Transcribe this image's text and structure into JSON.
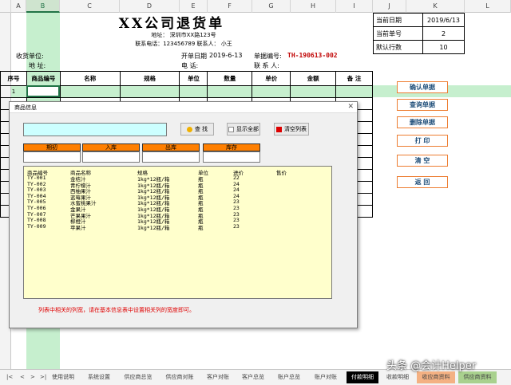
{
  "columns": [
    "A",
    "B",
    "C",
    "D",
    "E",
    "F",
    "G",
    "H",
    "I",
    "J",
    "K",
    "L"
  ],
  "title": "XX公司退货单",
  "address": "地址： 深圳市XX路123号",
  "contact": "联系电话：123456789  联系人： 小王",
  "receiver_label": "收货单位:",
  "address_label": "地    址:",
  "date_label": "开单日期",
  "date_value": "2019-6-13",
  "phone_label": "电    话:",
  "doc_no_label": "单据编号:",
  "doc_no_value": "TH-190613-002",
  "contact_label": "联 系 人:",
  "info": {
    "date_label": "当前日期",
    "date_value": "2019/6/13",
    "no_label": "当前单号",
    "no_value": "2",
    "rows_label": "默认行数",
    "rows_value": "10"
  },
  "table_headers": [
    "序号",
    "商品编号",
    "名称",
    "规格",
    "单位",
    "数量",
    "单价",
    "金额",
    "备 注"
  ],
  "first_row_no": "1",
  "side_buttons": [
    "确认单据",
    "查询单据",
    "删除单据",
    "打  印",
    "清  空",
    "返  回"
  ],
  "dialog": {
    "title": "商品信息",
    "search_btn": "查  找",
    "show_all_btn": "显示全部",
    "clear_btn": "清空列表",
    "stat_headers": [
      "期初",
      "入库",
      "出库",
      "库存"
    ],
    "list_headers": [
      "商品编号",
      "商品名称",
      "规格",
      "单位",
      "进价",
      "售价"
    ],
    "items": [
      [
        "TY-001",
        "金桔汁",
        "1kg*12瓶/箱",
        "瓶",
        "22",
        ""
      ],
      [
        "TY-002",
        "青柠檬汁",
        "1kg*12瓶/箱",
        "瓶",
        "24",
        ""
      ],
      [
        "TY-003",
        "西柚果汁",
        "1kg*12瓶/箱",
        "瓶",
        "24",
        ""
      ],
      [
        "TY-004",
        "蓝莓果汁",
        "1kg*12瓶/箱",
        "瓶",
        "24",
        ""
      ],
      [
        "TY-005",
        "水蜜桃果汁",
        "1kg*12瓶/箱",
        "瓶",
        "23",
        ""
      ],
      [
        "TY-006",
        "金果汁",
        "1kg*12瓶/箱",
        "瓶",
        "23",
        ""
      ],
      [
        "TY-007",
        "芒果果汁",
        "1kg*12瓶/箱",
        "瓶",
        "23",
        ""
      ],
      [
        "TY-008",
        "柳橙汁",
        "1kg*12瓶/箱",
        "瓶",
        "23",
        ""
      ],
      [
        "TY-009",
        "苹果汁",
        "1kg*12瓶/箱",
        "瓶",
        "23",
        ""
      ]
    ],
    "hint": "列表中相关的列宽，请在基本信息表中设置相关列的宽度即可。"
  },
  "sheet_tabs": [
    "使用说明",
    "系统设置",
    "供应商总览",
    "供应商对账",
    "客户对账",
    "客户总览",
    "账户总览",
    "账户对账",
    "付款明细",
    "收款明细",
    "收应商资料",
    "供应商资料"
  ],
  "watermark": "头条 @会计Helper",
  "colors": {
    "accent_orange": "#ff7f00",
    "excel_green": "#217346",
    "list_bg": "#ffffcc",
    "search_bg": "#ccffff"
  }
}
